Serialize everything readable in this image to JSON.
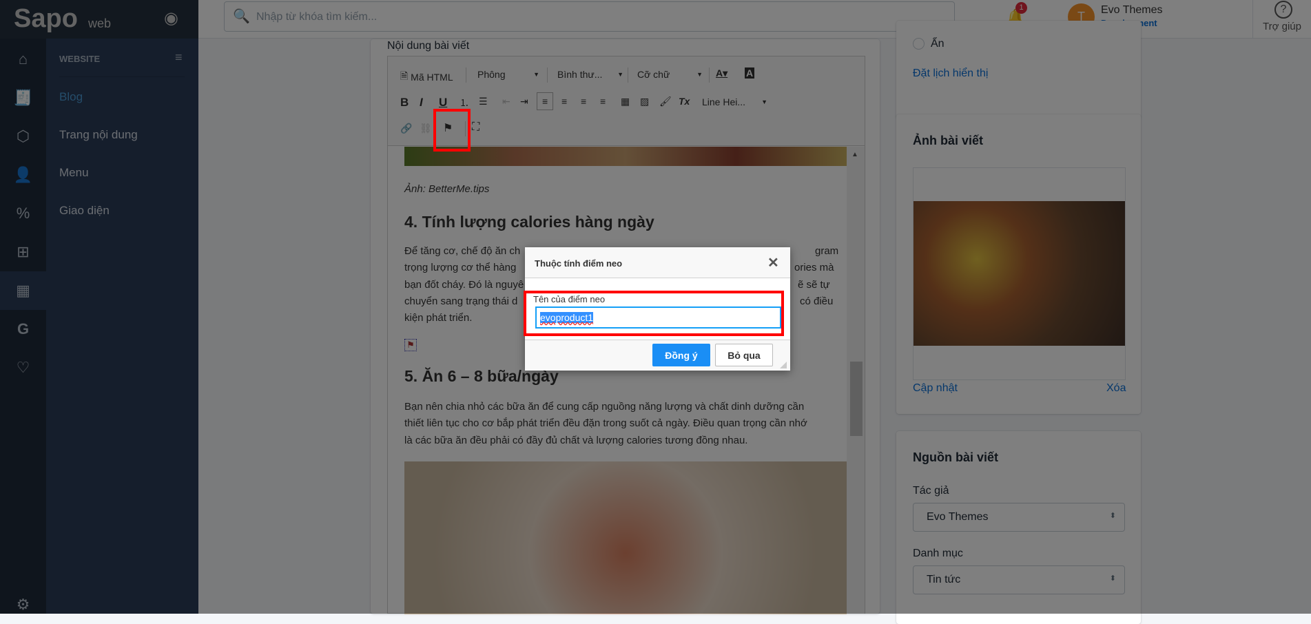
{
  "logo": {
    "brand": "Sapo",
    "suffix": "web"
  },
  "sidebar": {
    "section": "WEBSITE",
    "items": [
      {
        "label": "Blog",
        "active": true
      },
      {
        "label": "Trang nội dung"
      },
      {
        "label": "Menu"
      },
      {
        "label": "Giao diện"
      }
    ]
  },
  "topbar": {
    "search_placeholder": "Nhập từ khóa tìm kiếm...",
    "notification_count": "1",
    "avatar_initial": "T",
    "user_name": "Evo Themes",
    "user_role": "Development",
    "help_label": "Trợ giúp"
  },
  "editor": {
    "label": "Nội dung bài viết",
    "toolbar": {
      "html": "Mã HTML",
      "font": "Phông",
      "format": "Bình thư...",
      "size": "Cỡ chữ",
      "line_height": "Line Hei..."
    },
    "caption": "Ảnh: BetterMe.tips",
    "heading4": "4. Tính lượng calories hàng ngày",
    "para1_left": [
      "Để tăng cơ, chế độ ăn ch",
      "trọng lượng cơ thể hàng",
      "bạn đốt cháy. Đó là nguyê",
      "chuyển sang trạng thái d",
      "kiện phát triển."
    ],
    "para1_right": [
      "gram",
      "ories mà",
      "ẽ sẽ tự",
      "có điều",
      ""
    ],
    "heading5": "5. Ăn 6 – 8 bữa/ngày",
    "para2": [
      "Bạn nên chia nhỏ các bữa ăn để cung cấp nguồng năng lượng và chất dinh dưỡng cần",
      "thiết liên tục cho cơ bắp phát triển đều đặn trong suốt cả ngày. Điều quan trọng cần nhớ",
      "là các bữa ăn đều phải có đầy đủ chất và lượng calories tương đồng nhau."
    ]
  },
  "visibility": {
    "hidden_label": "Ẩn",
    "schedule_link": "Đặt lịch hiển thị"
  },
  "image_card": {
    "title": "Ảnh bài viết",
    "update": "Cập nhật",
    "delete": "Xóa"
  },
  "source_card": {
    "title": "Nguồn bài viết",
    "author_label": "Tác giả",
    "author_value": "Evo Themes",
    "category_label": "Danh mục",
    "category_value": "Tin tức"
  },
  "dialog": {
    "title": "Thuộc tính điểm neo",
    "field_label": "Tên của điểm neo",
    "field_value": "evoproduct1",
    "ok": "Đồng ý",
    "cancel": "Bỏ qua"
  }
}
